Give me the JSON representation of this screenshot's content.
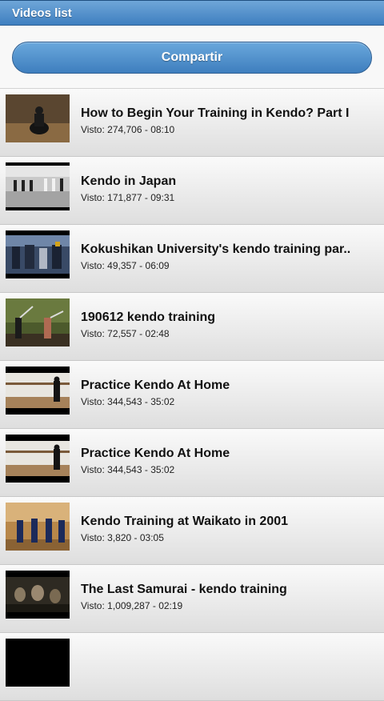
{
  "header": {
    "title": "Videos list"
  },
  "share": {
    "label": "Compartir"
  },
  "videos": [
    {
      "title": "How to Begin Your Training in Kendo? Part I",
      "views_label": "Visto",
      "views": "274,706",
      "duration": "08:10",
      "thumb_icon": "kendo-kneeling-icon"
    },
    {
      "title": "Kendo in Japan",
      "views_label": "Visto",
      "views": "171,877",
      "duration": "09:31",
      "thumb_icon": "dojo-hall-icon"
    },
    {
      "title": "Kokushikan University's kendo training par..",
      "views_label": "Visto",
      "views": "49,357",
      "duration": "06:09",
      "thumb_icon": "group-training-icon"
    },
    {
      "title": "190612 kendo training",
      "views_label": "Visto",
      "views": "72,557",
      "duration": "02:48",
      "thumb_icon": "practice-strike-icon"
    },
    {
      "title": "Practice Kendo At Home",
      "views_label": "Visto",
      "views": "344,543",
      "duration": "35:02",
      "thumb_icon": "solo-practice-icon"
    },
    {
      "title": "Practice Kendo At Home",
      "views_label": "Visto",
      "views": "344,543",
      "duration": "35:02",
      "thumb_icon": "solo-practice-icon"
    },
    {
      "title": "Kendo Training at Waikato in 2001",
      "views_label": "Visto",
      "views": "3,820",
      "duration": "03:05",
      "thumb_icon": "line-up-icon"
    },
    {
      "title": "The Last Samurai - kendo training",
      "views_label": "Visto",
      "views": "1,009,287",
      "duration": "02:19",
      "thumb_icon": "movie-scene-icon"
    }
  ]
}
